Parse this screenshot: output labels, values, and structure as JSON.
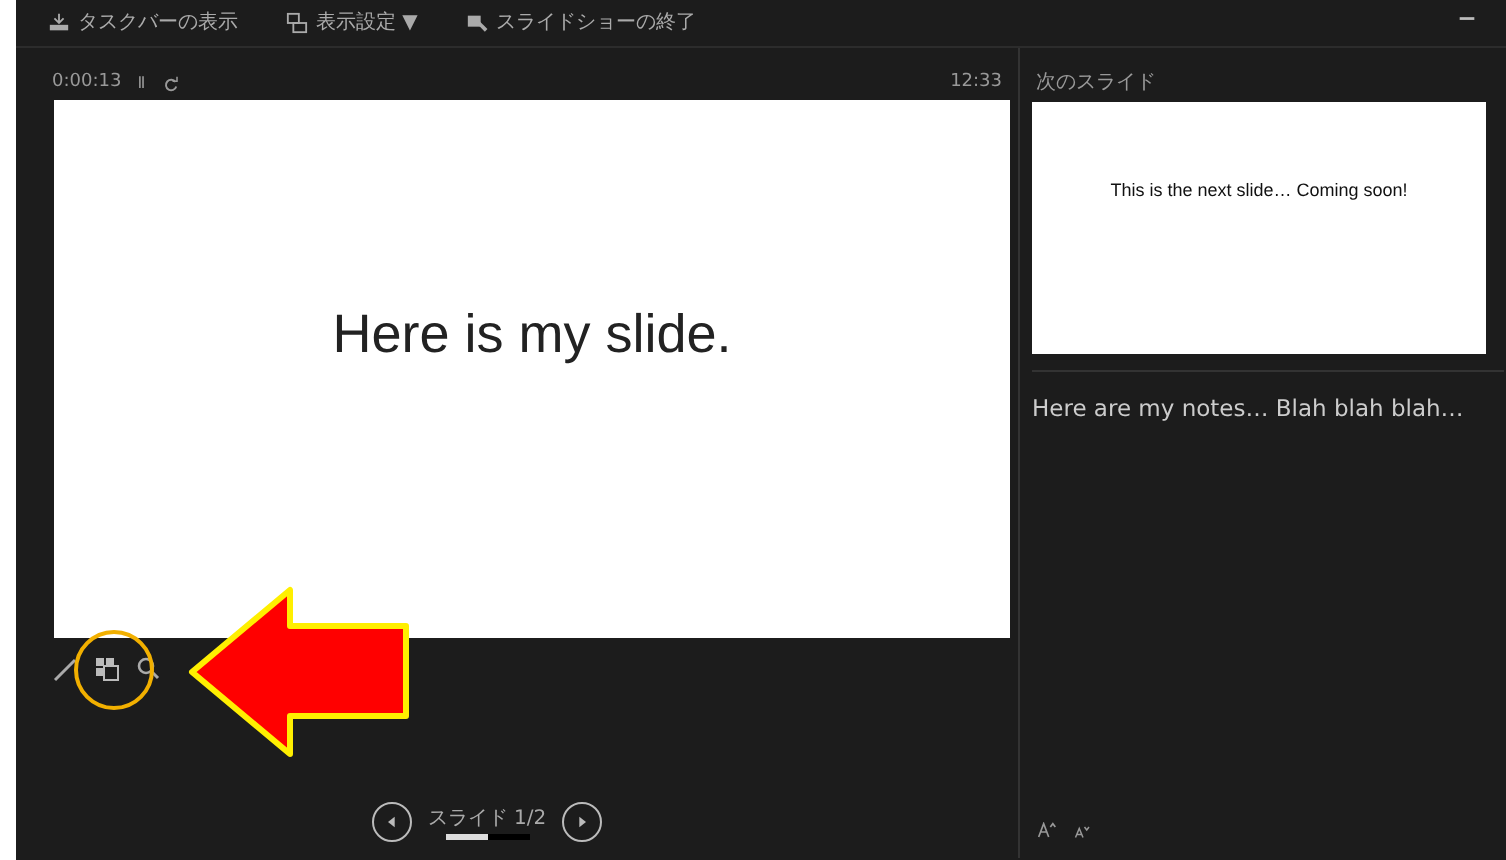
{
  "toolbar": [
    {
      "label": "タスクバーの表示"
    },
    {
      "label": "表示設定",
      "caret": "▼"
    },
    {
      "label": "スライドショーの終了"
    }
  ],
  "timer": {
    "elapsed": "0:00:13",
    "pause": "Ⅱ",
    "clock": "12:33"
  },
  "current_slide": {
    "text": "Here is my slide."
  },
  "navigation": {
    "label": "スライド 1/2",
    "level": 0.5
  },
  "next_slide": {
    "heading": "次のスライド",
    "text": "This is the next slide… Coming soon!"
  },
  "notes": {
    "text": "Here are my notes… Blah blah blah…"
  }
}
